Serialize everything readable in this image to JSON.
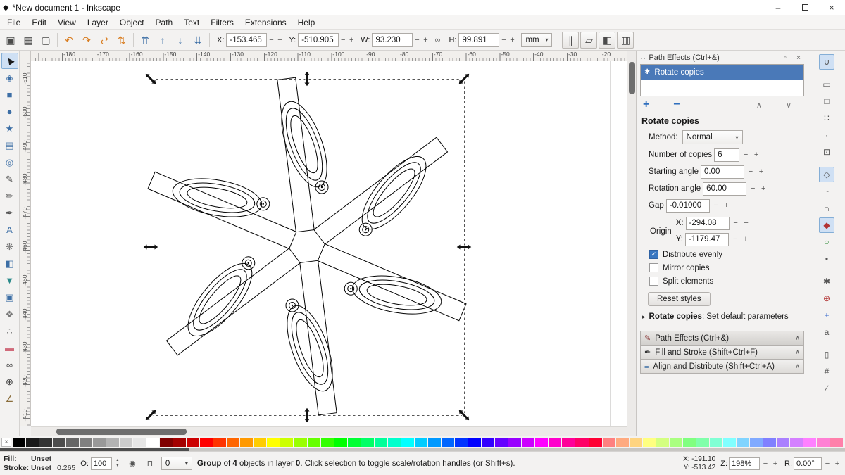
{
  "window": {
    "title": "*New document 1 - Inkscape"
  },
  "menu": {
    "items": [
      "File",
      "Edit",
      "View",
      "Layer",
      "Object",
      "Path",
      "Text",
      "Filters",
      "Extensions",
      "Help"
    ]
  },
  "toolbar": {
    "icons": [
      {
        "name": "select-all-icon",
        "glyph": "▣"
      },
      {
        "name": "select-all-layers-icon",
        "glyph": "▦"
      },
      {
        "name": "deselect-icon",
        "glyph": "▢"
      },
      {
        "sep": true
      },
      {
        "name": "rotate-ccw-icon",
        "glyph": "↶",
        "color": "#d97e22"
      },
      {
        "name": "rotate-cw-icon",
        "glyph": "↷",
        "color": "#d97e22"
      },
      {
        "name": "flip-horizontal-icon",
        "glyph": "⇄",
        "color": "#d97e22"
      },
      {
        "name": "flip-vertical-icon",
        "glyph": "⇅",
        "color": "#d97e22"
      },
      {
        "sep": true
      },
      {
        "name": "raise-to-top-icon",
        "glyph": "⇈",
        "color": "#3c6ea5"
      },
      {
        "name": "raise-icon",
        "glyph": "↑",
        "color": "#3c6ea5"
      },
      {
        "name": "lower-icon",
        "glyph": "↓",
        "color": "#3c6ea5"
      },
      {
        "name": "lower-to-bottom-icon",
        "glyph": "⇊",
        "color": "#3c6ea5"
      },
      {
        "sep": true
      }
    ],
    "fields": [
      {
        "label": "X:",
        "value": "-153.465"
      },
      {
        "label": "Y:",
        "value": "-510.905"
      },
      {
        "label": "W:",
        "value": "93.230"
      },
      {
        "label": "H:",
        "value": "99.891"
      }
    ],
    "units": {
      "value": "mm"
    },
    "toggles": [
      {
        "name": "scale-stroke",
        "glyph": "∥"
      },
      {
        "name": "scale-corners",
        "glyph": "▱"
      },
      {
        "name": "move-gradients",
        "glyph": "◧"
      },
      {
        "name": "move-patterns",
        "glyph": "▥"
      }
    ]
  },
  "toolbox": {
    "tools": [
      {
        "name": "selector-tool",
        "glyph": "▶",
        "color": "#1a1a1a",
        "cls": "rot-nw",
        "selected": true
      },
      {
        "name": "node-tool",
        "glyph": "◈",
        "color": "#3c6ea5"
      },
      {
        "name": "rectangle-tool",
        "glyph": "■",
        "color": "#3c6ea5"
      },
      {
        "name": "ellipse-tool",
        "glyph": "●",
        "color": "#3c6ea5"
      },
      {
        "name": "star-tool",
        "glyph": "★",
        "color": "#3c6ea5"
      },
      {
        "name": "box3d-tool",
        "glyph": "▤",
        "color": "#3c6ea5"
      },
      {
        "name": "spiral-tool",
        "glyph": "◎",
        "color": "#3c6ea5"
      },
      {
        "name": "pencil-tool",
        "glyph": "✎",
        "color": "#555555"
      },
      {
        "name": "pen-tool",
        "glyph": "✏",
        "color": "#555555"
      },
      {
        "name": "calligraphy-tool",
        "glyph": "✒",
        "color": "#555555"
      },
      {
        "name": "text-tool",
        "glyph": "A",
        "color": "#3c6ea5"
      },
      {
        "name": "sculpt-tool",
        "glyph": "❋",
        "color": "#777777"
      },
      {
        "name": "gradient-tool",
        "glyph": "◧",
        "color": "#3c6ea5"
      },
      {
        "name": "dropper-tool",
        "glyph": "▼",
        "color": "#2a8a8a"
      },
      {
        "name": "bucket-fill-tool",
        "glyph": "▣",
        "color": "#3c6ea5"
      },
      {
        "name": "tweak-tool",
        "glyph": "❖",
        "color": "#777777"
      },
      {
        "name": "spray-tool",
        "glyph": "∴",
        "color": "#777777"
      },
      {
        "name": "eraser-tool",
        "glyph": "▬",
        "color": "#d06a7a"
      },
      {
        "name": "connector-tool",
        "glyph": "∞",
        "color": "#555555"
      },
      {
        "name": "zoom-tool",
        "glyph": "⊕",
        "color": "#444444"
      },
      {
        "name": "measure-tool",
        "glyph": "∠",
        "color": "#8a6d3b"
      }
    ]
  },
  "rulers": {
    "top_labels": [
      "-180",
      "-170",
      "-160",
      "-150",
      "-140",
      "-130",
      "-120",
      "-110",
      "-100",
      "-90",
      "-80",
      "-70",
      "-60",
      "-50",
      "-40",
      "-30",
      "-20"
    ],
    "left_labels": [
      "-510",
      "-500",
      "-490",
      "-480",
      "-470",
      "-460",
      "-450",
      "-440",
      "-430",
      "-420",
      "-410"
    ]
  },
  "canvas": {
    "copies": 6,
    "rotation_step": 60
  },
  "path_effects": {
    "title": "Path Effects (Ctrl+&)",
    "effect_item": "Rotate copies",
    "heading": "Rotate copies",
    "method_label": "Method:",
    "method_value": "Normal",
    "params": [
      {
        "label": "Number of copies",
        "value": "6"
      },
      {
        "label": "Starting angle",
        "value": "0.00"
      },
      {
        "label": "Rotation angle",
        "value": "60.00"
      },
      {
        "label": "Gap",
        "value": "-0.01000"
      }
    ],
    "origin_label": "Origin",
    "origin_x_label": "X:",
    "origin_x_value": "-294.08",
    "origin_y_label": "Y:",
    "origin_y_value": "-1179.47",
    "checkboxes": [
      {
        "label": "Distribute evenly",
        "checked": true
      },
      {
        "label": "Mirror copies",
        "checked": false
      },
      {
        "label": "Split elements",
        "checked": false
      }
    ],
    "reset_button": "Reset styles",
    "expander_bold": "Rotate copies",
    "expander_rest": ": Set default parameters"
  },
  "dock_tabs": [
    {
      "label": "Path Effects (Ctrl+&)",
      "icon": "✎",
      "color": "#8b3a3a"
    },
    {
      "label": "Fill and Stroke (Shift+Ctrl+F)",
      "icon": "✒",
      "color": "#333333"
    },
    {
      "label": "Align and Distribute (Shift+Ctrl+A)",
      "icon": "≡",
      "color": "#3c6ea5"
    }
  ],
  "snapbar": {
    "items": [
      {
        "name": "snap-toggle",
        "glyph": "∪",
        "active": true
      },
      {
        "name": "snap-bbox",
        "glyph": "▭",
        "gap": true
      },
      {
        "name": "snap-bbox-edges",
        "glyph": "□"
      },
      {
        "name": "snap-bbox-corners",
        "glyph": "∷"
      },
      {
        "name": "snap-bbox-edge-midpoints",
        "glyph": "·"
      },
      {
        "name": "snap-bbox-centers",
        "glyph": "⊡"
      },
      {
        "name": "snap-nodes",
        "glyph": "◇",
        "gap": true,
        "active": true
      },
      {
        "name": "snap-paths",
        "glyph": "~"
      },
      {
        "name": "snap-path-intersections",
        "glyph": "∩"
      },
      {
        "name": "snap-cusp-nodes",
        "glyph": "◆",
        "color": "#b23333",
        "active": true
      },
      {
        "name": "snap-smooth-nodes",
        "glyph": "○",
        "color": "#2a8833"
      },
      {
        "name": "snap-line-midpoints",
        "glyph": "•"
      },
      {
        "name": "snap-others",
        "glyph": "✱",
        "gap": true
      },
      {
        "name": "snap-object-centers",
        "glyph": "⊕",
        "color": "#b23333"
      },
      {
        "name": "snap-rotation-centers",
        "glyph": "+",
        "color": "#3366cc"
      },
      {
        "name": "snap-text-baselines",
        "glyph": "a"
      },
      {
        "name": "snap-page-border",
        "glyph": "▯",
        "gap": true
      },
      {
        "name": "snap-grids",
        "glyph": "#"
      },
      {
        "name": "snap-guides",
        "glyph": "∕"
      }
    ]
  },
  "palette": {
    "colors": [
      "#000000",
      "#1a1a1a",
      "#333333",
      "#4d4d4d",
      "#666666",
      "#808080",
      "#999999",
      "#b3b3b3",
      "#cccccc",
      "#e6e6e6",
      "#ffffff",
      "#800000",
      "#a40000",
      "#cc0000",
      "#ff0000",
      "#ff3300",
      "#ff6600",
      "#ff9900",
      "#ffcc00",
      "#ffff00",
      "#ccff00",
      "#99ff00",
      "#66ff00",
      "#33ff00",
      "#00ff00",
      "#00ff33",
      "#00ff66",
      "#00ff99",
      "#00ffcc",
      "#00ffff",
      "#00ccff",
      "#0099ff",
      "#0066ff",
      "#0033ff",
      "#0000ff",
      "#3300ff",
      "#6600ff",
      "#9900ff",
      "#cc00ff",
      "#ff00ff",
      "#ff00cc",
      "#ff0099",
      "#ff0066",
      "#ff0033",
      "#ff8080",
      "#ffaa80",
      "#ffd480",
      "#ffff80",
      "#d4ff80",
      "#aaff80",
      "#80ff80",
      "#80ffaa",
      "#80ffd4",
      "#80ffff",
      "#80d4ff",
      "#80aaff",
      "#8080ff",
      "#aa80ff",
      "#d480ff",
      "#ff80ff",
      "#ff80d4",
      "#ff80aa"
    ]
  },
  "status": {
    "fill_label": "Fill:",
    "fill_value": "Unset",
    "stroke_label": "Stroke:",
    "stroke_value": "Unset",
    "stroke_width": "0.265",
    "opacity_label": "O:",
    "opacity_value": "100",
    "layer_value": "0",
    "message_parts": [
      {
        "t": "Group",
        "b": true
      },
      {
        "t": " of "
      },
      {
        "t": "4",
        "b": true
      },
      {
        "t": " objects in layer "
      },
      {
        "t": "0",
        "b": true
      },
      {
        "t": ". Click selection to toggle scale/rotation handles (or Shift+s)."
      }
    ],
    "x_label": "X:",
    "x_value": "-191.10",
    "y_label": "Y:",
    "y_value": "-513.42",
    "zoom_label": "Z:",
    "zoom_value": "198%",
    "rotation_label": "R:",
    "rotation_value": "0.00°"
  }
}
